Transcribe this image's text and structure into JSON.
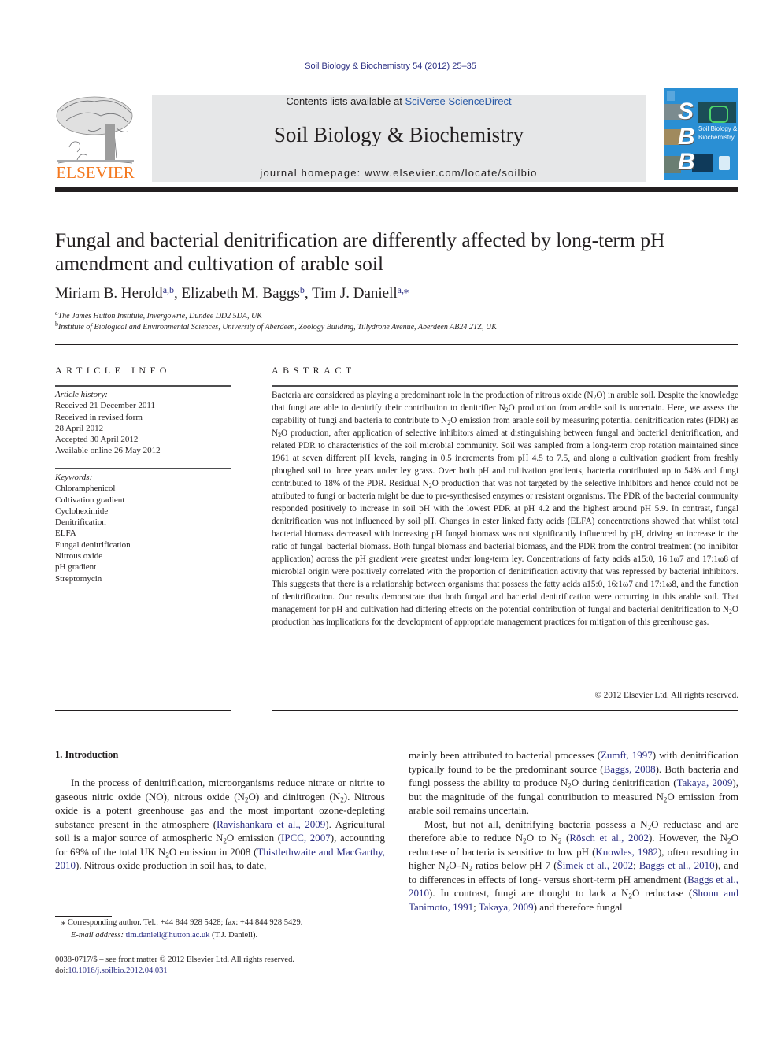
{
  "header": {
    "running_head": "Soil Biology & Biochemistry 54 (2012) 25–35",
    "contents_prefix": "Contents lists available at ",
    "contents_link": "SciVerse ScienceDirect",
    "journal_name": "Soil Biology & Biochemistry",
    "homepage": "journal homepage: www.elsevier.com/locate/soilbio",
    "publisher_logo_text": "ELSEVIER",
    "cover": {
      "letters": [
        "S",
        "B",
        "B"
      ],
      "title_line1": "Soil Biology &",
      "title_line2": "Biochemistry",
      "color": "#2a8fd4"
    },
    "colors": {
      "publisher_orange": "#f47920",
      "link_blue": "#2b2e83"
    }
  },
  "article": {
    "title": "Fungal and bacterial denitrification are differently affected by long-term pH amendment and cultivation of arable soil",
    "authors": [
      {
        "name": "Miriam B. Herold",
        "affil": "a,b"
      },
      {
        "name": "Elizabeth M. Baggs",
        "affil": "b"
      },
      {
        "name": "Tim J. Daniell",
        "affil": "a,⁎"
      }
    ],
    "affiliations": [
      {
        "key": "a",
        "text": "The James Hutton Institute, Invergowrie, Dundee DD2 5DA, UK"
      },
      {
        "key": "b",
        "text": "Institute of Biological and Environmental Sciences, University of Aberdeen, Zoology Building, Tillydrone Avenue, Aberdeen AB24 2TZ, UK"
      }
    ]
  },
  "article_info": {
    "heading": "ARTICLE INFO",
    "history_label": "Article history:",
    "history": [
      "Received 21 December 2011",
      "Received in revised form",
      "28 April 2012",
      "Accepted 30 April 2012",
      "Available online 26 May 2012"
    ],
    "keywords_label": "Keywords:",
    "keywords": [
      "Chloramphenicol",
      "Cultivation gradient",
      "Cycloheximide",
      "Denitrification",
      "ELFA",
      "Fungal denitrification",
      "Nitrous oxide",
      "pH gradient",
      "Streptomycin"
    ]
  },
  "abstract": {
    "heading": "ABSTRACT",
    "segments": [
      {
        "t": "Bacteria are considered as playing a predominant role in the production of nitrous oxide (N"
      },
      {
        "sub": "2"
      },
      {
        "t": "O) in arable soil. Despite the knowledge that fungi are able to denitrify their contribution to denitrifier N"
      },
      {
        "sub": "2"
      },
      {
        "t": "O production from arable soil is uncertain. Here, we assess the capability of fungi and bacteria to contribute to N"
      },
      {
        "sub": "2"
      },
      {
        "t": "O emission from arable soil by measuring potential denitrification rates (PDR) as N"
      },
      {
        "sub": "2"
      },
      {
        "t": "O production, after application of selective inhibitors aimed at distinguishing between fungal and bacterial denitrifi­cation, and related PDR to characteristics of the soil microbial community. Soil was sampled from a long-term crop rotation maintained since 1961 at seven different pH levels, ranging in 0.5 increments from pH 4.5 to 7.5, and along a cultivation gradient from freshly ploughed soil to three years under ley grass. Over both pH and cultivation gradients, bacteria contributed up to 54% and fungi contributed to 18% of the PDR. Residual N"
      },
      {
        "sub": "2"
      },
      {
        "t": "O production that was not targeted by the selective inhibitors and hence could not be attributed to fungi or bacteria might be due to pre-synthesised enzymes or resistant organisms. The PDR of the bacterial community responded positively to increase in soil pH with the lowest PDR at pH 4.2 and the highest around pH 5.9. In contrast, fungal denitrification was not influenced by soil pH. Changes in ester linked fatty acids (ELFA) concentrations showed that whilst total bacterial biomass decreased with increasing pH fungal biomass was not significantly influenced by pH, driving an increase in the ratio of fungal–bacterial biomass. Both fungal biomass and bacterial biomass, and the PDR from the control treatment (no inhibitor application) across the pH gradient were greatest under long-term ley. Concentrations of fatty acids a15:0, 16:1ω7 and 17:1ω8 of microbial origin were positively correlated with the proportion of denitrification activity that was repressed by bacterial inhibitors. This suggests that there is a relationship between organisms that possess the fatty acids a15:0, 16:1ω7 and 17:1ω8, and the function of denitrification. Our results demonstrate that both fungal and bacterial denitrification were occurring in this arable soil. That management for pH and cultivation had differing effects on the potential contribution of fungal and bacterial denitrification to N"
      },
      {
        "sub": "2"
      },
      {
        "t": "O production has implications for the development of appropriate management practices for mitigation of this greenhouse gas."
      }
    ],
    "copyright": "© 2012 Elsevier Ltd. All rights reserved."
  },
  "introduction": {
    "heading": "1.  Introduction",
    "left_column": [
      {
        "t": "In the process of denitrification, microorganisms reduce nitrate or nitrite to gaseous nitric oxide (NO), nitrous oxide (N"
      },
      {
        "sub": "2"
      },
      {
        "t": "O) and di­nitrogen (N"
      },
      {
        "sub": "2"
      },
      {
        "t": "). Nitrous oxide is a potent greenhouse gas and the most important ozone-depleting substance present in the atmo­sphere ("
      },
      {
        "link": "Ravishankara et al., 2009"
      },
      {
        "t": "). Agricultural soil is a major source of atmospheric N"
      },
      {
        "sub": "2"
      },
      {
        "t": "O emission ("
      },
      {
        "link": "IPCC, 2007"
      },
      {
        "t": "), accounting for 69% of the total UK N"
      },
      {
        "sub": "2"
      },
      {
        "t": "O emission in 2008 ("
      },
      {
        "link": "Thistlethwaite and MacGarthy, 2010"
      },
      {
        "t": "). Nitrous oxide production in soil has, to date,"
      }
    ],
    "right_column_p1": [
      {
        "t": "mainly been attributed to bacterial processes ("
      },
      {
        "link": "Zumft, 1997"
      },
      {
        "t": ") with denitrification typically found to be the predominant source ("
      },
      {
        "link": "Baggs, 2008"
      },
      {
        "t": "). Both bacteria and fungi possess the ability to produce N"
      },
      {
        "sub": "2"
      },
      {
        "t": "O during denitrification ("
      },
      {
        "link": "Takaya, 2009"
      },
      {
        "t": "), but the magnitude of the fungal contribution to measured N"
      },
      {
        "sub": "2"
      },
      {
        "t": "O emission from arable soil remains uncertain."
      }
    ],
    "right_column_p2": [
      {
        "t": "Most, but not all, denitrifying bacteria possess a N"
      },
      {
        "sub": "2"
      },
      {
        "t": "O reductase and are therefore able to reduce N"
      },
      {
        "sub": "2"
      },
      {
        "t": "O to N"
      },
      {
        "sub": "2"
      },
      {
        "t": " ("
      },
      {
        "link": "Rösch et al., 2002"
      },
      {
        "t": "). However, the N"
      },
      {
        "sub": "2"
      },
      {
        "t": "O reductase of bacteria is sensitive to low pH ("
      },
      {
        "link": "Knowles, 1982"
      },
      {
        "t": "), often resulting in higher N"
      },
      {
        "sub": "2"
      },
      {
        "t": "O–N"
      },
      {
        "sub": "2"
      },
      {
        "t": " ratios below pH 7 ("
      },
      {
        "link": "Šimek et al., 2002"
      },
      {
        "t": "; "
      },
      {
        "link": "Baggs et al., 2010"
      },
      {
        "t": "), and to differences in effects of long- versus short-term pH amendment ("
      },
      {
        "link": "Baggs et al., 2010"
      },
      {
        "t": "). In contrast, fungi are thought to lack a N"
      },
      {
        "sub": "2"
      },
      {
        "t": "O reductase ("
      },
      {
        "link": "Shoun and Tanimoto, 1991"
      },
      {
        "t": "; "
      },
      {
        "link": "Takaya, 2009"
      },
      {
        "t": ") and therefore fungal"
      }
    ]
  },
  "footnotes": {
    "corresponding": "⁎  Corresponding author. Tel.: +44 844 928 5428; fax: +44 844 928 5429.",
    "email_label": "E-mail address:",
    "email": "tim.daniell@hutton.ac.uk",
    "email_suffix": " (T.J. Daniell).",
    "issn": "0038-0717/$ – see front matter © 2012 Elsevier Ltd. All rights reserved.",
    "doi_prefix": "doi:",
    "doi": "10.1016/j.soilbio.2012.04.031"
  }
}
